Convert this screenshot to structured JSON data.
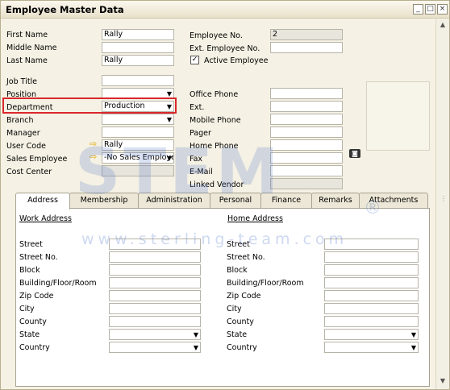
{
  "window": {
    "title": "Employee Master Data",
    "minimize_glyph": "_",
    "maximize_glyph": "□",
    "close_glyph": "×"
  },
  "left_fields": {
    "first_name_label": "First Name",
    "first_name_value": "Rally",
    "middle_name_label": "Middle Name",
    "middle_name_value": "",
    "last_name_label": "Last Name",
    "last_name_value": "Rally",
    "job_title_label": "Job Title",
    "job_title_value": "",
    "position_label": "Position",
    "position_value": "",
    "department_label": "Department",
    "department_value": "Production",
    "branch_label": "Branch",
    "branch_value": "",
    "manager_label": "Manager",
    "manager_value": "",
    "user_code_label": "User Code",
    "user_code_value": "Rally",
    "sales_employee_label": "Sales Employee",
    "sales_employee_value": "-No Sales Employee-",
    "cost_center_label": "Cost Center",
    "cost_center_value": ""
  },
  "right_fields": {
    "employee_no_label": "Employee No.",
    "employee_no_value": "2",
    "ext_employee_no_label": "Ext. Employee No.",
    "ext_employee_no_value": "",
    "active_employee_label": "Active Employee",
    "active_employee_check": "✓",
    "office_phone_label": "Office Phone",
    "ext_label": "Ext.",
    "mobile_phone_label": "Mobile Phone",
    "pager_label": "Pager",
    "home_phone_label": "Home Phone",
    "fax_label": "Fax",
    "email_label": "E-Mail",
    "linked_vendor_label": "Linked Vendor"
  },
  "tabs": [
    "Address",
    "Membership",
    "Administration",
    "Personal",
    "Finance",
    "Remarks",
    "Attachments"
  ],
  "address": {
    "work_title": "Work Address",
    "home_title": "Home Address",
    "rows": [
      "Street",
      "Street No.",
      "Block",
      "Building/Floor/Room",
      "Zip Code",
      "City",
      "County",
      "State",
      "Country"
    ]
  },
  "watermark": {
    "logo": "STEM",
    "registered": "®",
    "url": "www.sterling-team.com"
  },
  "icons": {
    "dropdown": "▼",
    "link_arrow": "⇨",
    "camera": "◙",
    "scroll_up": "▲",
    "scroll_down": "▼",
    "scroll_grip": "⋮"
  }
}
